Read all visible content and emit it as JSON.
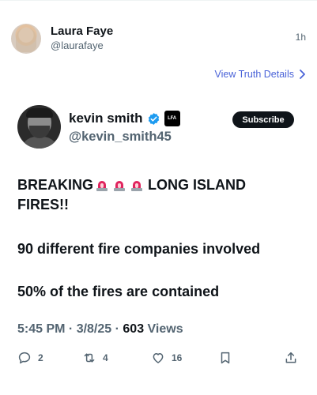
{
  "truth_post": {
    "author_name": "Laura Faye",
    "author_handle": "@laurafaye",
    "time": "1h",
    "view_details_label": "View Truth Details"
  },
  "embedded_post": {
    "author_name": "kevin smith",
    "author_handle": "@kevin_smith45",
    "affiliate_badge": "LFA",
    "subscribe_label": "Subscribe",
    "text": {
      "line1_start": "BREAKING",
      "line1_end": "LONG ISLAND",
      "line2": "FIRES!!",
      "line3": "90 different fire companies involved",
      "line4": "50% of the fires are contained"
    },
    "meta": {
      "time": "5:45 PM",
      "sep1": " · ",
      "date": "3/8/25",
      "sep2": " · ",
      "views_count": "603",
      "views_label": " Views"
    }
  },
  "actions": {
    "replies": "2",
    "retweets": "4",
    "likes": "16"
  },
  "colors": {
    "link": "#4a63d8",
    "verified": "#1d9bf0",
    "muted": "#536471",
    "text": "#0f1419"
  }
}
